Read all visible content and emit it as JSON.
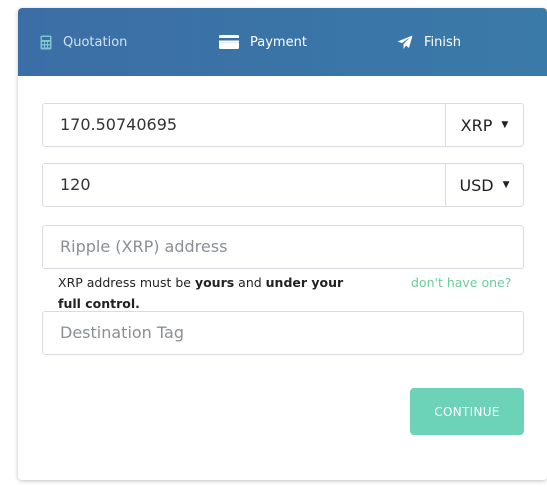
{
  "steps": [
    {
      "label": "Quotation",
      "icon": "calculator-icon"
    },
    {
      "label": "Payment",
      "icon": "credit-card-icon"
    },
    {
      "label": "Finish",
      "icon": "paper-plane-icon"
    }
  ],
  "form": {
    "crypto_amount": "170.50740695",
    "crypto_currency": "XRP",
    "fiat_amount": "120",
    "fiat_currency": "USD",
    "address_placeholder": "Ripple (XRP) address",
    "note_prefix": "XRP address must be ",
    "note_bold1": "yours",
    "note_mid": " and ",
    "note_bold2": "under your full control.",
    "no_address_link": "don't have one?",
    "destination_tag_placeholder": "Destination Tag",
    "continue_label": "CONTINUE"
  },
  "colors": {
    "header": "#3b6ea6",
    "accent": "#6cd2b8",
    "link": "#6ccb9b"
  }
}
